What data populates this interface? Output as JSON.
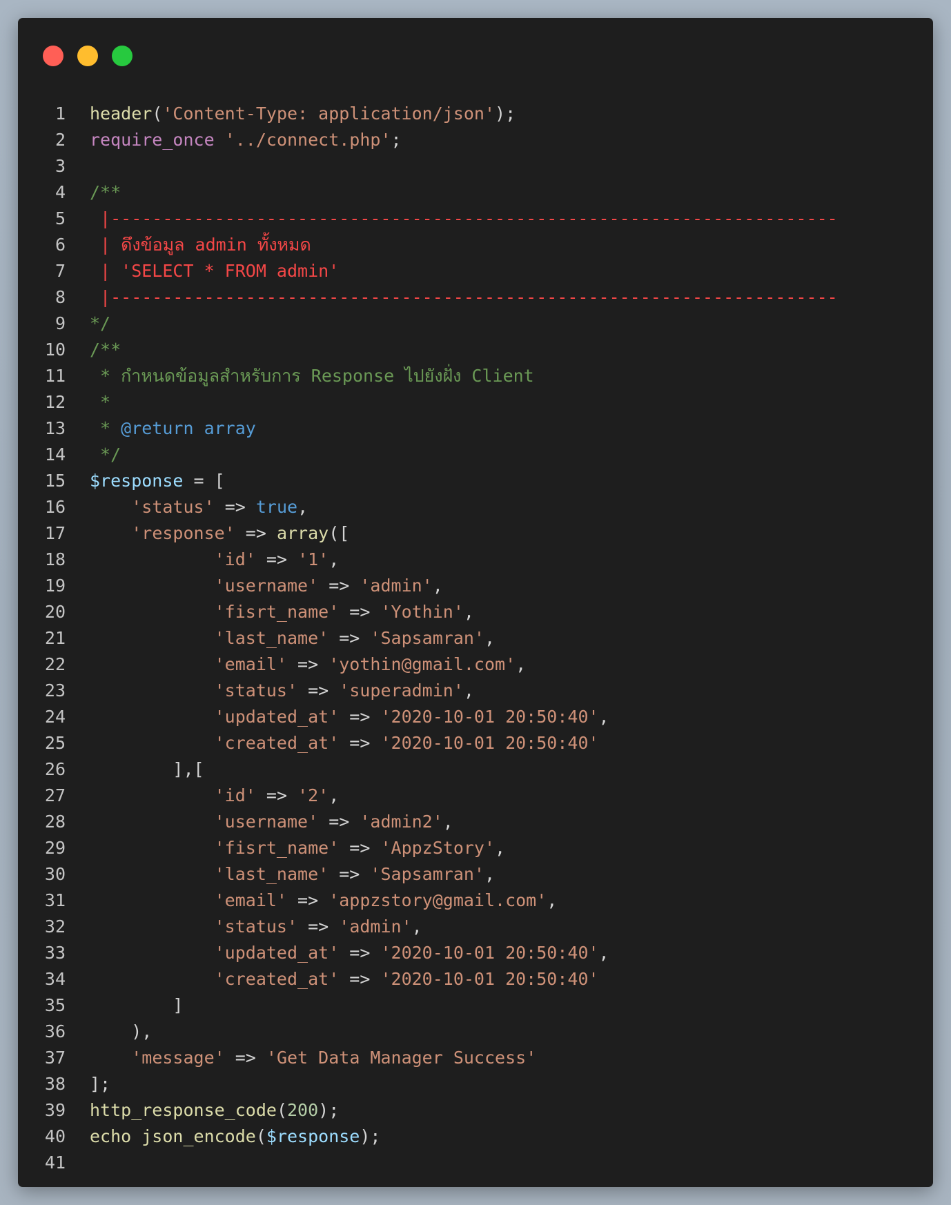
{
  "window": {
    "buttons": [
      "close",
      "minimize",
      "maximize"
    ]
  },
  "colors": {
    "background": "#1e1e1e",
    "default": "#d4d4d4",
    "function": "#dcdcaa",
    "string": "#ce9178",
    "keyword": "#c586c0",
    "comment": "#6a9955",
    "error_comment": "#f44747",
    "variable": "#9cdcfe",
    "constant": "#569cd6",
    "number": "#b5cea8"
  },
  "lines": [
    [
      [
        "fn",
        "header"
      ],
      [
        "sp",
        "("
      ],
      [
        "str",
        "'Content-Type: application/json'"
      ],
      [
        "sp",
        ");"
      ]
    ],
    [
      [
        "kw",
        "require_once"
      ],
      [
        "sp",
        " "
      ],
      [
        "str",
        "'../connect.php'"
      ],
      [
        "sp",
        ";"
      ]
    ],
    [],
    [
      [
        "com",
        "/**"
      ]
    ],
    [
      [
        "red",
        " |----------------------------------------------------------------------"
      ]
    ],
    [
      [
        "red",
        " | ดึงข้อมูล admin ทั้งหมด"
      ]
    ],
    [
      [
        "red",
        " | 'SELECT * FROM admin'"
      ]
    ],
    [
      [
        "red",
        " |----------------------------------------------------------------------"
      ]
    ],
    [
      [
        "com",
        "*/"
      ]
    ],
    [
      [
        "com",
        "/**"
      ]
    ],
    [
      [
        "com",
        " * กำหนดข้อมูลสำหรับการ Response ไปยังฝั่ง Client"
      ]
    ],
    [
      [
        "com",
        " *"
      ]
    ],
    [
      [
        "com",
        " * "
      ],
      [
        "tag",
        "@return array"
      ]
    ],
    [
      [
        "com",
        " */"
      ]
    ],
    [
      [
        "var",
        "$response"
      ],
      [
        "sp",
        " = ["
      ]
    ],
    [
      [
        "sp",
        "    "
      ],
      [
        "str",
        "'status'"
      ],
      [
        "sp",
        " => "
      ],
      [
        "bool",
        "true"
      ],
      [
        "sp",
        ","
      ]
    ],
    [
      [
        "sp",
        "    "
      ],
      [
        "str",
        "'response'"
      ],
      [
        "sp",
        " => "
      ],
      [
        "fn",
        "array"
      ],
      [
        "sp",
        "(["
      ]
    ],
    [
      [
        "sp",
        "            "
      ],
      [
        "str",
        "'id'"
      ],
      [
        "sp",
        " => "
      ],
      [
        "str",
        "'1'"
      ],
      [
        "sp",
        ","
      ]
    ],
    [
      [
        "sp",
        "            "
      ],
      [
        "str",
        "'username'"
      ],
      [
        "sp",
        " => "
      ],
      [
        "str",
        "'admin'"
      ],
      [
        "sp",
        ","
      ]
    ],
    [
      [
        "sp",
        "            "
      ],
      [
        "str",
        "'fisrt_name'"
      ],
      [
        "sp",
        " => "
      ],
      [
        "str",
        "'Yothin'"
      ],
      [
        "sp",
        ","
      ]
    ],
    [
      [
        "sp",
        "            "
      ],
      [
        "str",
        "'last_name'"
      ],
      [
        "sp",
        " => "
      ],
      [
        "str",
        "'Sapsamran'"
      ],
      [
        "sp",
        ","
      ]
    ],
    [
      [
        "sp",
        "            "
      ],
      [
        "str",
        "'email'"
      ],
      [
        "sp",
        " => "
      ],
      [
        "str",
        "'yothin@gmail.com'"
      ],
      [
        "sp",
        ","
      ]
    ],
    [
      [
        "sp",
        "            "
      ],
      [
        "str",
        "'status'"
      ],
      [
        "sp",
        " => "
      ],
      [
        "str",
        "'superadmin'"
      ],
      [
        "sp",
        ","
      ]
    ],
    [
      [
        "sp",
        "            "
      ],
      [
        "str",
        "'updated_at'"
      ],
      [
        "sp",
        " => "
      ],
      [
        "str",
        "'2020-10-01 20:50:40'"
      ],
      [
        "sp",
        ","
      ]
    ],
    [
      [
        "sp",
        "            "
      ],
      [
        "str",
        "'created_at'"
      ],
      [
        "sp",
        " => "
      ],
      [
        "str",
        "'2020-10-01 20:50:40'"
      ]
    ],
    [
      [
        "sp",
        "        ],["
      ]
    ],
    [
      [
        "sp",
        "            "
      ],
      [
        "str",
        "'id'"
      ],
      [
        "sp",
        " => "
      ],
      [
        "str",
        "'2'"
      ],
      [
        "sp",
        ","
      ]
    ],
    [
      [
        "sp",
        "            "
      ],
      [
        "str",
        "'username'"
      ],
      [
        "sp",
        " => "
      ],
      [
        "str",
        "'admin2'"
      ],
      [
        "sp",
        ","
      ]
    ],
    [
      [
        "sp",
        "            "
      ],
      [
        "str",
        "'fisrt_name'"
      ],
      [
        "sp",
        " => "
      ],
      [
        "str",
        "'AppzStory'"
      ],
      [
        "sp",
        ","
      ]
    ],
    [
      [
        "sp",
        "            "
      ],
      [
        "str",
        "'last_name'"
      ],
      [
        "sp",
        " => "
      ],
      [
        "str",
        "'Sapsamran'"
      ],
      [
        "sp",
        ","
      ]
    ],
    [
      [
        "sp",
        "            "
      ],
      [
        "str",
        "'email'"
      ],
      [
        "sp",
        " => "
      ],
      [
        "str",
        "'appzstory@gmail.com'"
      ],
      [
        "sp",
        ","
      ]
    ],
    [
      [
        "sp",
        "            "
      ],
      [
        "str",
        "'status'"
      ],
      [
        "sp",
        " => "
      ],
      [
        "str",
        "'admin'"
      ],
      [
        "sp",
        ","
      ]
    ],
    [
      [
        "sp",
        "            "
      ],
      [
        "str",
        "'updated_at'"
      ],
      [
        "sp",
        " => "
      ],
      [
        "str",
        "'2020-10-01 20:50:40'"
      ],
      [
        "sp",
        ","
      ]
    ],
    [
      [
        "sp",
        "            "
      ],
      [
        "str",
        "'created_at'"
      ],
      [
        "sp",
        " => "
      ],
      [
        "str",
        "'2020-10-01 20:50:40'"
      ]
    ],
    [
      [
        "sp",
        "        ]"
      ]
    ],
    [
      [
        "sp",
        "    ),"
      ]
    ],
    [
      [
        "sp",
        "    "
      ],
      [
        "str",
        "'message'"
      ],
      [
        "sp",
        " => "
      ],
      [
        "str",
        "'Get Data Manager Success'"
      ]
    ],
    [
      [
        "sp",
        "];"
      ]
    ],
    [
      [
        "fn",
        "http_response_code"
      ],
      [
        "sp",
        "("
      ],
      [
        "num",
        "200"
      ],
      [
        "sp",
        ");"
      ]
    ],
    [
      [
        "fn",
        "echo json_encode"
      ],
      [
        "sp",
        "("
      ],
      [
        "var",
        "$response"
      ],
      [
        "sp",
        ");"
      ]
    ],
    []
  ]
}
